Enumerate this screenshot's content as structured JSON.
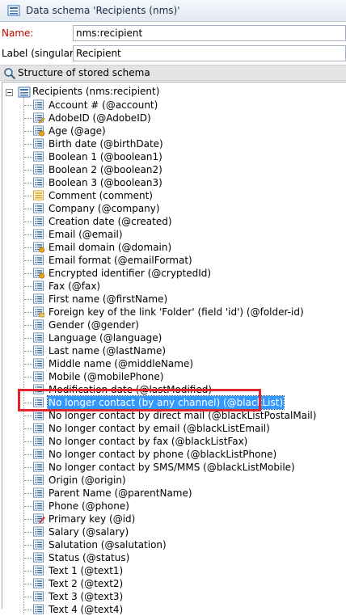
{
  "window": {
    "title": "Data schema 'Recipients (nms)'"
  },
  "form": {
    "name_label": "Name:",
    "name_value": "nms:recipient",
    "singular_label": "Label (singular):",
    "singular_value": "Recipient"
  },
  "structure": {
    "header": "Structure of stored schema"
  },
  "tree": {
    "root": "Recipients (nms:recipient)",
    "items": [
      {
        "label": "Account # (@account)",
        "icon": "attribute-icon"
      },
      {
        "label": "AdobeID (@AdobeID)",
        "icon": "attribute-edit-icon"
      },
      {
        "label": "Age (@age)",
        "icon": "computed-attribute-icon"
      },
      {
        "label": "Birth date (@birthDate)",
        "icon": "attribute-icon"
      },
      {
        "label": "Boolean 1 (@boolean1)",
        "icon": "attribute-icon"
      },
      {
        "label": "Boolean 2 (@boolean2)",
        "icon": "attribute-icon"
      },
      {
        "label": "Boolean 3 (@boolean3)",
        "icon": "attribute-icon"
      },
      {
        "label": "Comment (comment)",
        "icon": "element-icon"
      },
      {
        "label": "Company (@company)",
        "icon": "attribute-icon"
      },
      {
        "label": "Creation date (@created)",
        "icon": "attribute-icon"
      },
      {
        "label": "Email (@email)",
        "icon": "attribute-icon"
      },
      {
        "label": "Email domain (@domain)",
        "icon": "computed-attribute-icon"
      },
      {
        "label": "Email format (@emailFormat)",
        "icon": "attribute-icon"
      },
      {
        "label": "Encrypted identifier (@cryptedId)",
        "icon": "computed-attribute-icon"
      },
      {
        "label": "Fax (@fax)",
        "icon": "attribute-icon"
      },
      {
        "label": "First name (@firstName)",
        "icon": "attribute-icon"
      },
      {
        "label": "Foreign key of the link 'Folder' (field 'id') (@folder-id)",
        "icon": "foreign-key-icon"
      },
      {
        "label": "Gender (@gender)",
        "icon": "attribute-icon"
      },
      {
        "label": "Language (@language)",
        "icon": "attribute-icon"
      },
      {
        "label": "Last name (@lastName)",
        "icon": "attribute-icon"
      },
      {
        "label": "Middle name (@middleName)",
        "icon": "attribute-icon"
      },
      {
        "label": "Mobile (@mobilePhone)",
        "icon": "attribute-icon"
      },
      {
        "label": "Modification date (@lastModified)",
        "icon": "attribute-icon"
      },
      {
        "label": "No longer contact (by any channel) (@blackList)",
        "icon": "attribute-icon",
        "selected": true
      },
      {
        "label": "No longer contact by direct mail (@blackListPostalMail)",
        "icon": "attribute-icon"
      },
      {
        "label": "No longer contact by email (@blackListEmail)",
        "icon": "attribute-icon"
      },
      {
        "label": "No longer contact by fax (@blackListFax)",
        "icon": "attribute-icon"
      },
      {
        "label": "No longer contact by phone (@blackListPhone)",
        "icon": "attribute-icon"
      },
      {
        "label": "No longer contact by SMS/MMS (@blackListMobile)",
        "icon": "attribute-icon"
      },
      {
        "label": "Origin (@origin)",
        "icon": "attribute-icon"
      },
      {
        "label": "Parent Name (@parentName)",
        "icon": "attribute-icon"
      },
      {
        "label": "Phone (@phone)",
        "icon": "attribute-icon"
      },
      {
        "label": "Primary key (@id)",
        "icon": "primary-key-icon"
      },
      {
        "label": "Salary (@salary)",
        "icon": "attribute-icon"
      },
      {
        "label": "Salutation (@salutation)",
        "icon": "attribute-icon"
      },
      {
        "label": "Status (@status)",
        "icon": "attribute-icon"
      },
      {
        "label": "Text 1 (@text1)",
        "icon": "attribute-icon"
      },
      {
        "label": "Text 2 (@text2)",
        "icon": "attribute-icon"
      },
      {
        "label": "Text 3 (@text3)",
        "icon": "attribute-icon"
      },
      {
        "label": "Text 4 (@text4)",
        "icon": "attribute-icon"
      }
    ]
  },
  "colors": {
    "selection": "#3399ff",
    "annotation": "#e0242c",
    "required_label": "#c00000"
  }
}
